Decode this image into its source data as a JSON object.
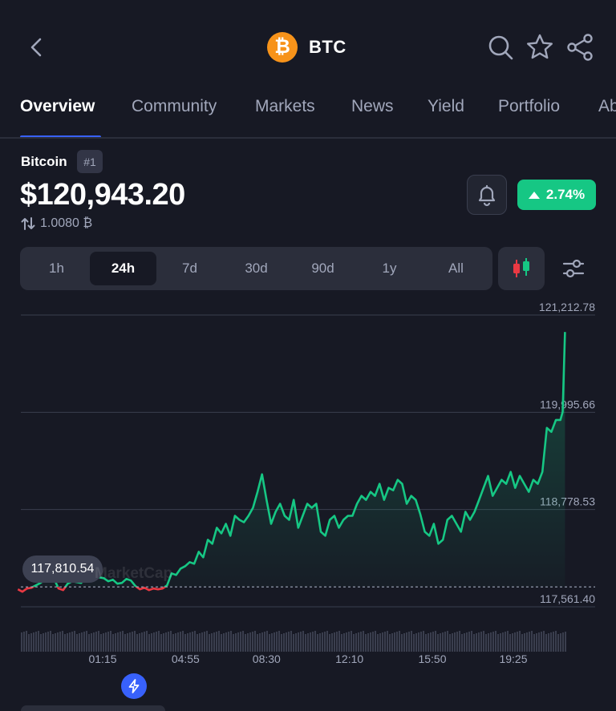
{
  "header": {
    "symbol": "BTC",
    "logo_glyph": "₿",
    "icons": [
      "back-icon",
      "search-icon",
      "star-icon",
      "share-icon"
    ]
  },
  "tabs": [
    {
      "label": "Overview",
      "active": true
    },
    {
      "label": "Community"
    },
    {
      "label": "Markets"
    },
    {
      "label": "News"
    },
    {
      "label": "Yield"
    },
    {
      "label": "Portfolio"
    },
    {
      "label": "Ab"
    }
  ],
  "coin": {
    "name": "Bitcoin",
    "rank": "#1",
    "price": "$120,943.20",
    "btc_value": "1.0080 ₿",
    "change": "2.74%",
    "change_direction": "up"
  },
  "ranges": [
    {
      "label": "1h"
    },
    {
      "label": "24h",
      "active": true
    },
    {
      "label": "7d"
    },
    {
      "label": "30d"
    },
    {
      "label": "90d"
    },
    {
      "label": "1y"
    },
    {
      "label": "All"
    }
  ],
  "colors": {
    "up": "#16C784",
    "down": "#EA3943",
    "accent": "#3861FB",
    "background": "#171924",
    "btc_orange": "#F7931A"
  },
  "chart_data": {
    "type": "line",
    "y_ticks": [
      "121,212.78",
      "119,995.66",
      "118,778.53",
      "117,561.40"
    ],
    "y_tick_values": [
      121212.78,
      119995.66,
      118778.53,
      117561.4
    ],
    "ylim": [
      117561.4,
      121212.78
    ],
    "x_ticks": [
      "01:15",
      "04:55",
      "08:30",
      "12:10",
      "15:50",
      "19:25"
    ],
    "x_tick_hours": [
      1.25,
      4.9167,
      8.5,
      12.1667,
      15.8333,
      19.4167
    ],
    "baseline": 117810.54,
    "baseline_label": "117,810.54",
    "watermark": "MarketCap",
    "x": [
      -2.5,
      -2.3,
      -2.1,
      -1.9,
      -1.7,
      -1.5,
      -1.3,
      -1.1,
      -0.9,
      -0.7,
      -0.5,
      -0.3,
      -0.1,
      0.1,
      0.3,
      0.5,
      0.7,
      0.9,
      1.1,
      1.3,
      1.5,
      1.7,
      1.9,
      2.1,
      2.3,
      2.5,
      2.7,
      2.9,
      3.1,
      3.3,
      3.5,
      3.7,
      3.9,
      4.1,
      4.3,
      4.5,
      4.7,
      4.9,
      5.1,
      5.3,
      5.5,
      5.7,
      5.9,
      6.1,
      6.3,
      6.5,
      6.7,
      6.9,
      7.1,
      7.3,
      7.5,
      7.7,
      7.9,
      8.1,
      8.3,
      8.5,
      8.7,
      8.9,
      9.1,
      9.3,
      9.5,
      9.7,
      9.9,
      10.1,
      10.3,
      10.5,
      10.7,
      10.9,
      11.1,
      11.3,
      11.5,
      11.7,
      11.9,
      12.1,
      12.3,
      12.5,
      12.7,
      12.9,
      13.1,
      13.3,
      13.5,
      13.7,
      13.9,
      14.1,
      14.3,
      14.5,
      14.7,
      14.9,
      15.1,
      15.3,
      15.5,
      15.7,
      15.9,
      16.1,
      16.3,
      16.5,
      16.7,
      16.9,
      17.1,
      17.3,
      17.5,
      17.7,
      17.9,
      18.1,
      18.3,
      18.5,
      18.7,
      18.9,
      19.1,
      19.3,
      19.5,
      19.7,
      19.9,
      20.1,
      20.3,
      20.5,
      20.7,
      20.9,
      21.1,
      21.3,
      21.5,
      21.6,
      21.7
    ],
    "values": [
      117780,
      117750,
      117790,
      117800,
      117830,
      117860,
      117900,
      117880,
      117910,
      117790,
      117770,
      117850,
      117880,
      117870,
      117860,
      117940,
      117910,
      117950,
      117930,
      117920,
      117880,
      117900,
      117850,
      117860,
      117910,
      117890,
      117820,
      117780,
      117800,
      117770,
      117790,
      117780,
      117790,
      117830,
      117980,
      117960,
      118040,
      118070,
      118120,
      118100,
      118250,
      118180,
      118400,
      118350,
      118550,
      118480,
      118600,
      118450,
      118700,
      118650,
      118620,
      118700,
      118800,
      119000,
      119220,
      118900,
      118600,
      118750,
      118850,
      118700,
      118650,
      118900,
      118550,
      118700,
      118850,
      118800,
      118850,
      118500,
      118450,
      118650,
      118700,
      118550,
      118650,
      118700,
      118700,
      118850,
      118950,
      118900,
      119000,
      118950,
      119100,
      118900,
      119050,
      119020,
      119150,
      119100,
      118850,
      118950,
      118900,
      118720,
      118500,
      118450,
      118600,
      118350,
      118400,
      118650,
      118700,
      118600,
      118500,
      118750,
      118650,
      118750,
      118900,
      119050,
      119200,
      118950,
      119050,
      119150,
      119100,
      119250,
      119050,
      119200,
      119100,
      119000,
      119150,
      119100,
      119250,
      119800,
      119750,
      119900,
      119900,
      120000,
      121000
    ]
  }
}
